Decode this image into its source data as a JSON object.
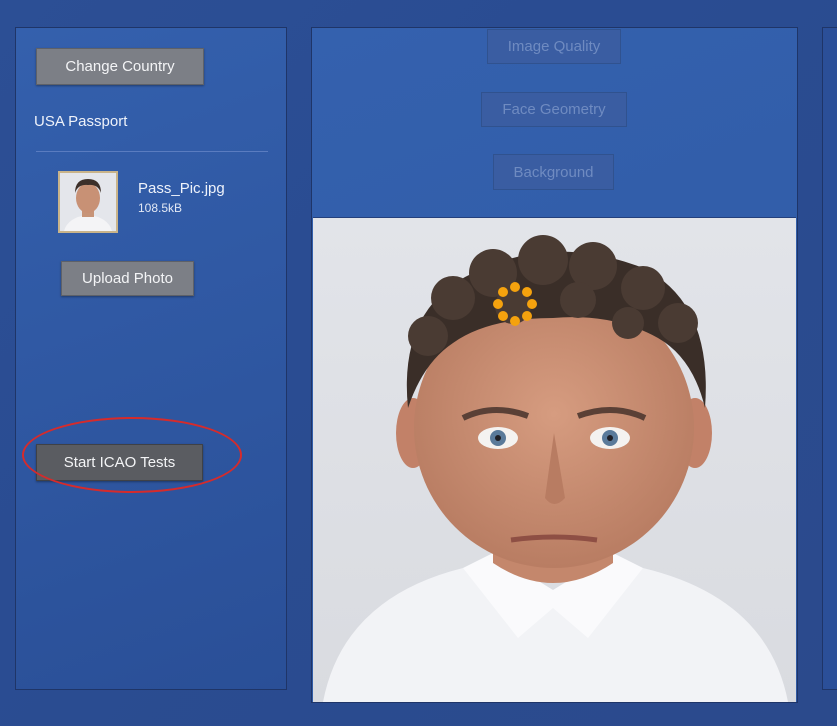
{
  "left_panel": {
    "change_country_label": "Change Country",
    "document_type": "USA Passport",
    "file": {
      "name": "Pass_Pic.jpg",
      "size": "108.5kB"
    },
    "upload_label": "Upload Photo",
    "start_tests_label": "Start ICAO Tests"
  },
  "tests": {
    "image_quality_label": "Image Quality",
    "face_geometry_label": "Face Geometry",
    "background_label": "Background"
  },
  "colors": {
    "background": "#2b4f98",
    "button": "#7c7f86",
    "highlight_ring": "#d62b2b",
    "spinner": "#f5a20e"
  },
  "icons": {
    "loading": "loading-spinner-icon"
  }
}
